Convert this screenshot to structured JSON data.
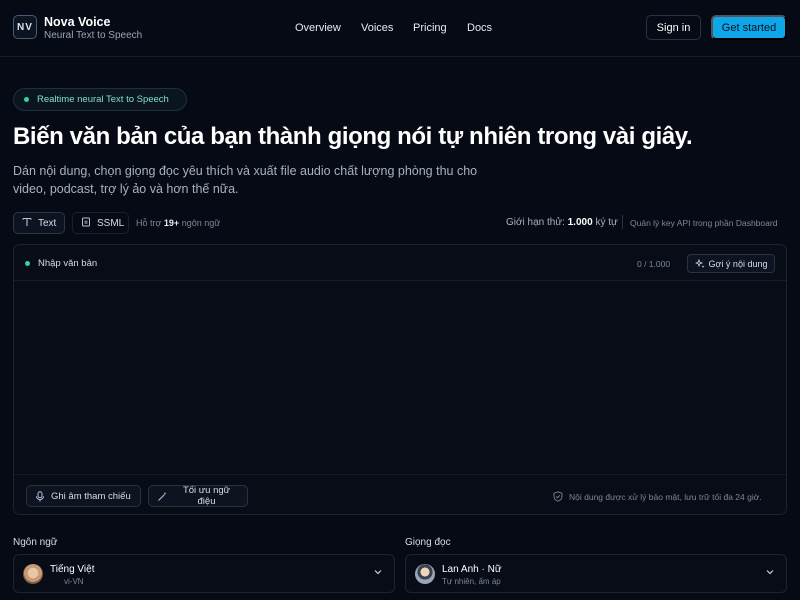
{
  "header": {
    "logo_text": "NV",
    "brand_name": "Nova Voice",
    "brand_subtitle": "Neural Text to Speech",
    "nav": [
      "Overview",
      "Voices",
      "Pricing",
      "Docs"
    ],
    "sign_in": "Sign in",
    "get_started": "Get started"
  },
  "hero": {
    "badge": "Realtime neural Text to Speech",
    "title": "Biến văn bản của bạn thành giọng nói tự nhiên trong vài giây.",
    "description": "Dán nội dung, chọn giọng đọc yêu thích và xuất file audio chất lượng phòng thu cho video, podcast, trợ lý ảo và hơn thế nữa."
  },
  "modes": {
    "text": "Text",
    "ssml": "SSML",
    "support_prefix": "Hỗ trợ",
    "support_count": "19+",
    "support_suffix": "ngôn ngữ"
  },
  "limit": {
    "prefix": "Giới hạn thử:",
    "value": "1.000",
    "suffix": "ký tự",
    "api_note": "Quản lý key API trong phần Dashboard"
  },
  "editor": {
    "label": "Nhập văn bản",
    "counter": "0 / 1.000",
    "suggest": "Gợi ý nội dung",
    "placeholder": "",
    "record": "Ghi âm tham chiếu",
    "optimize": "Tối ưu ngữ điệu",
    "secure_note": "Nội dung được xử lý bảo mật, lưu trữ tối đa 24 giờ."
  },
  "language": {
    "label": "Ngôn ngữ",
    "name": "Tiếng Việt",
    "code": "vi-VN"
  },
  "voice": {
    "label": "Giọng đọc",
    "name": "Lan Anh · Nữ",
    "description": "Tự nhiên, ấm áp"
  },
  "colors": {
    "accent": "#0ea5e9",
    "status_dot": "#34d399",
    "background": "#060a14"
  }
}
